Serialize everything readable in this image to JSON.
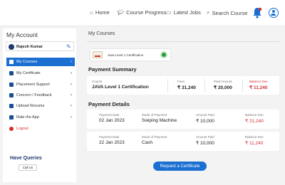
{
  "nav": {
    "home": "Home",
    "course_progress": "Course Progress",
    "latest_jobs": "Latest Jobs",
    "search_course": "Search Course"
  },
  "sidebar": {
    "title": "My Account",
    "profile_name": "Rajesh Kumar",
    "items": [
      {
        "label": "My Courses",
        "active": true
      },
      {
        "label": "My Certificate"
      },
      {
        "label": "Placement Support"
      },
      {
        "label": "Concern / Feedback"
      },
      {
        "label": "Upload Resume"
      },
      {
        "label": "Rate the App"
      },
      {
        "label": "Logout"
      }
    ],
    "queries_title": "Have Queries",
    "call_us": "Call Us"
  },
  "main": {
    "breadcrumb": "My Courses",
    "certificate_name": "Java Level 1 Certification",
    "payment_summary": {
      "heading": "Payment Summary",
      "course_label": "Course",
      "course_value": "JAVA Level 1 Certification",
      "fees_label": "Fees",
      "fees_value": "₹ 31,240",
      "paid_label": "Paid Amount",
      "paid_value": "₹ 20,000",
      "balance_label": "Balance Due",
      "balance_value": "₹ 11,240"
    },
    "payment_details": {
      "heading": "Payment Details",
      "rows": [
        {
          "date_label": "Payment Date",
          "date": "02 Jan 2023",
          "mode_label": "Mode of Payment",
          "mode": "Swiping Machine",
          "paid_label": "Amount Paid",
          "paid": "₹ 10,000",
          "balance_label": "Balance Due",
          "balance": "₹ 21,240"
        },
        {
          "date_label": "Payment Date",
          "date": "22 Jan 2023",
          "mode_label": "Mode of Payment",
          "mode": "Cash",
          "paid_label": "Amount Paid",
          "paid": "₹ 10,000",
          "balance_label": "Balance Due",
          "balance": "₹ 11,240"
        }
      ]
    },
    "request_button": "Request a Certificate"
  },
  "colors": {
    "accent": "#1a6fd1",
    "danger": "#d32f2f"
  }
}
